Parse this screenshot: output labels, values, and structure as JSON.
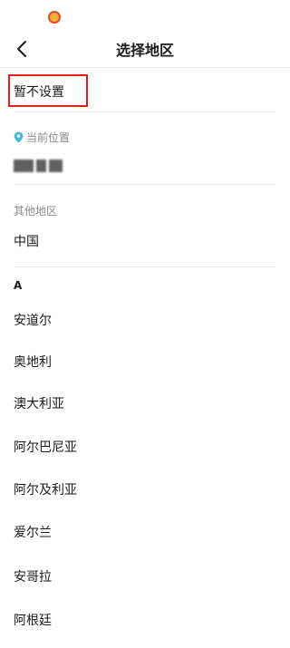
{
  "header": {
    "title": "选择地区"
  },
  "not_set": "暂不设置",
  "current_location": {
    "label": "当前位置"
  },
  "other_regions": {
    "label": "其他地区",
    "items": [
      "中国"
    ]
  },
  "sections": [
    {
      "letter": "A",
      "items": [
        "安道尔",
        "奥地利",
        "澳大利亚",
        "阿尔巴尼亚",
        "阿尔及利亚",
        "爱尔兰",
        "安哥拉",
        "阿根廷"
      ]
    }
  ],
  "colors": {
    "highlight": "#e21f1f",
    "location_pin": "#49b7d6"
  }
}
